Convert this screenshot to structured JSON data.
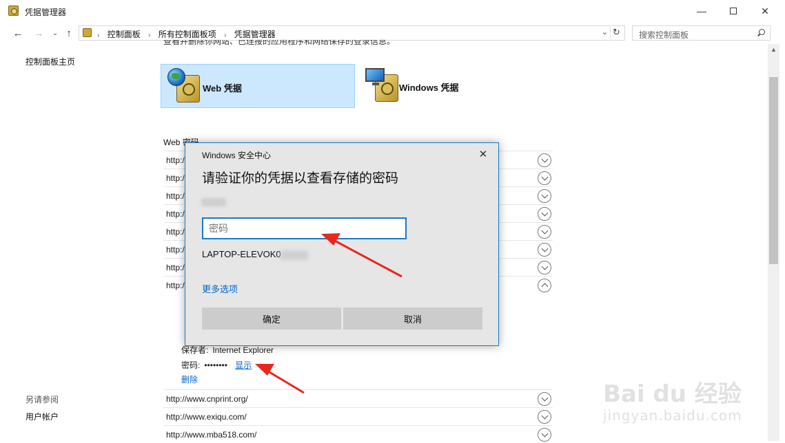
{
  "window": {
    "title": "凭据管理器",
    "min_glyph": "—",
    "close_glyph": "✕"
  },
  "nav": {
    "back_glyph": "←",
    "forward_glyph": "→",
    "recent_glyph": "⌄",
    "up_glyph": "↑",
    "breadcrumbs": [
      "控制面板",
      "所有控制面板项",
      "凭据管理器"
    ],
    "crumb_sep": "›",
    "dropdown_glyph": "⌄",
    "refresh_glyph": "↻",
    "search_placeholder": "搜索控制面板"
  },
  "left": {
    "home": "控制面板主页",
    "see_also": "另请参阅",
    "user_accounts": "用户帐户"
  },
  "main": {
    "cut_text": "查看并删除你网站、已连接的应用程序和网络保存的登录信息。",
    "tiles": {
      "web": "Web 凭据",
      "windows": "Windows 凭据"
    },
    "section_title": "Web 密码",
    "rows": [
      "http:/",
      "http:/",
      "http:/",
      "http:/",
      "http:/",
      "http:/",
      "http:/",
      "http:/"
    ],
    "expanded": {
      "saved_by_label": "保存者:",
      "saved_by_value": "Internet Explorer",
      "password_label": "密码:",
      "password_dots": "••••••••",
      "show": "显示",
      "delete": "删除"
    },
    "lower_rows": [
      "http://www.cnprint.org/",
      "http://www.exiqu.com/",
      "http://www.mba518.com/"
    ]
  },
  "dialog": {
    "title": "Windows 安全中心",
    "close_glyph": "✕",
    "heading": "请验证你的凭据以查看存储的密码",
    "password_placeholder": "密码",
    "domain": "LAPTOP-ELEVOK0",
    "more_options": "更多选项",
    "ok": "确定",
    "cancel": "取消"
  },
  "scroll": {
    "up_glyph": "▲"
  },
  "watermark": {
    "main": "Bai du 经验",
    "sub": "jingyan.baidu.com"
  },
  "colors": {
    "accent": "#1979ca",
    "tile_selected": "#cce8ff",
    "link": "#0066cc",
    "arrow": "#e8261c"
  }
}
